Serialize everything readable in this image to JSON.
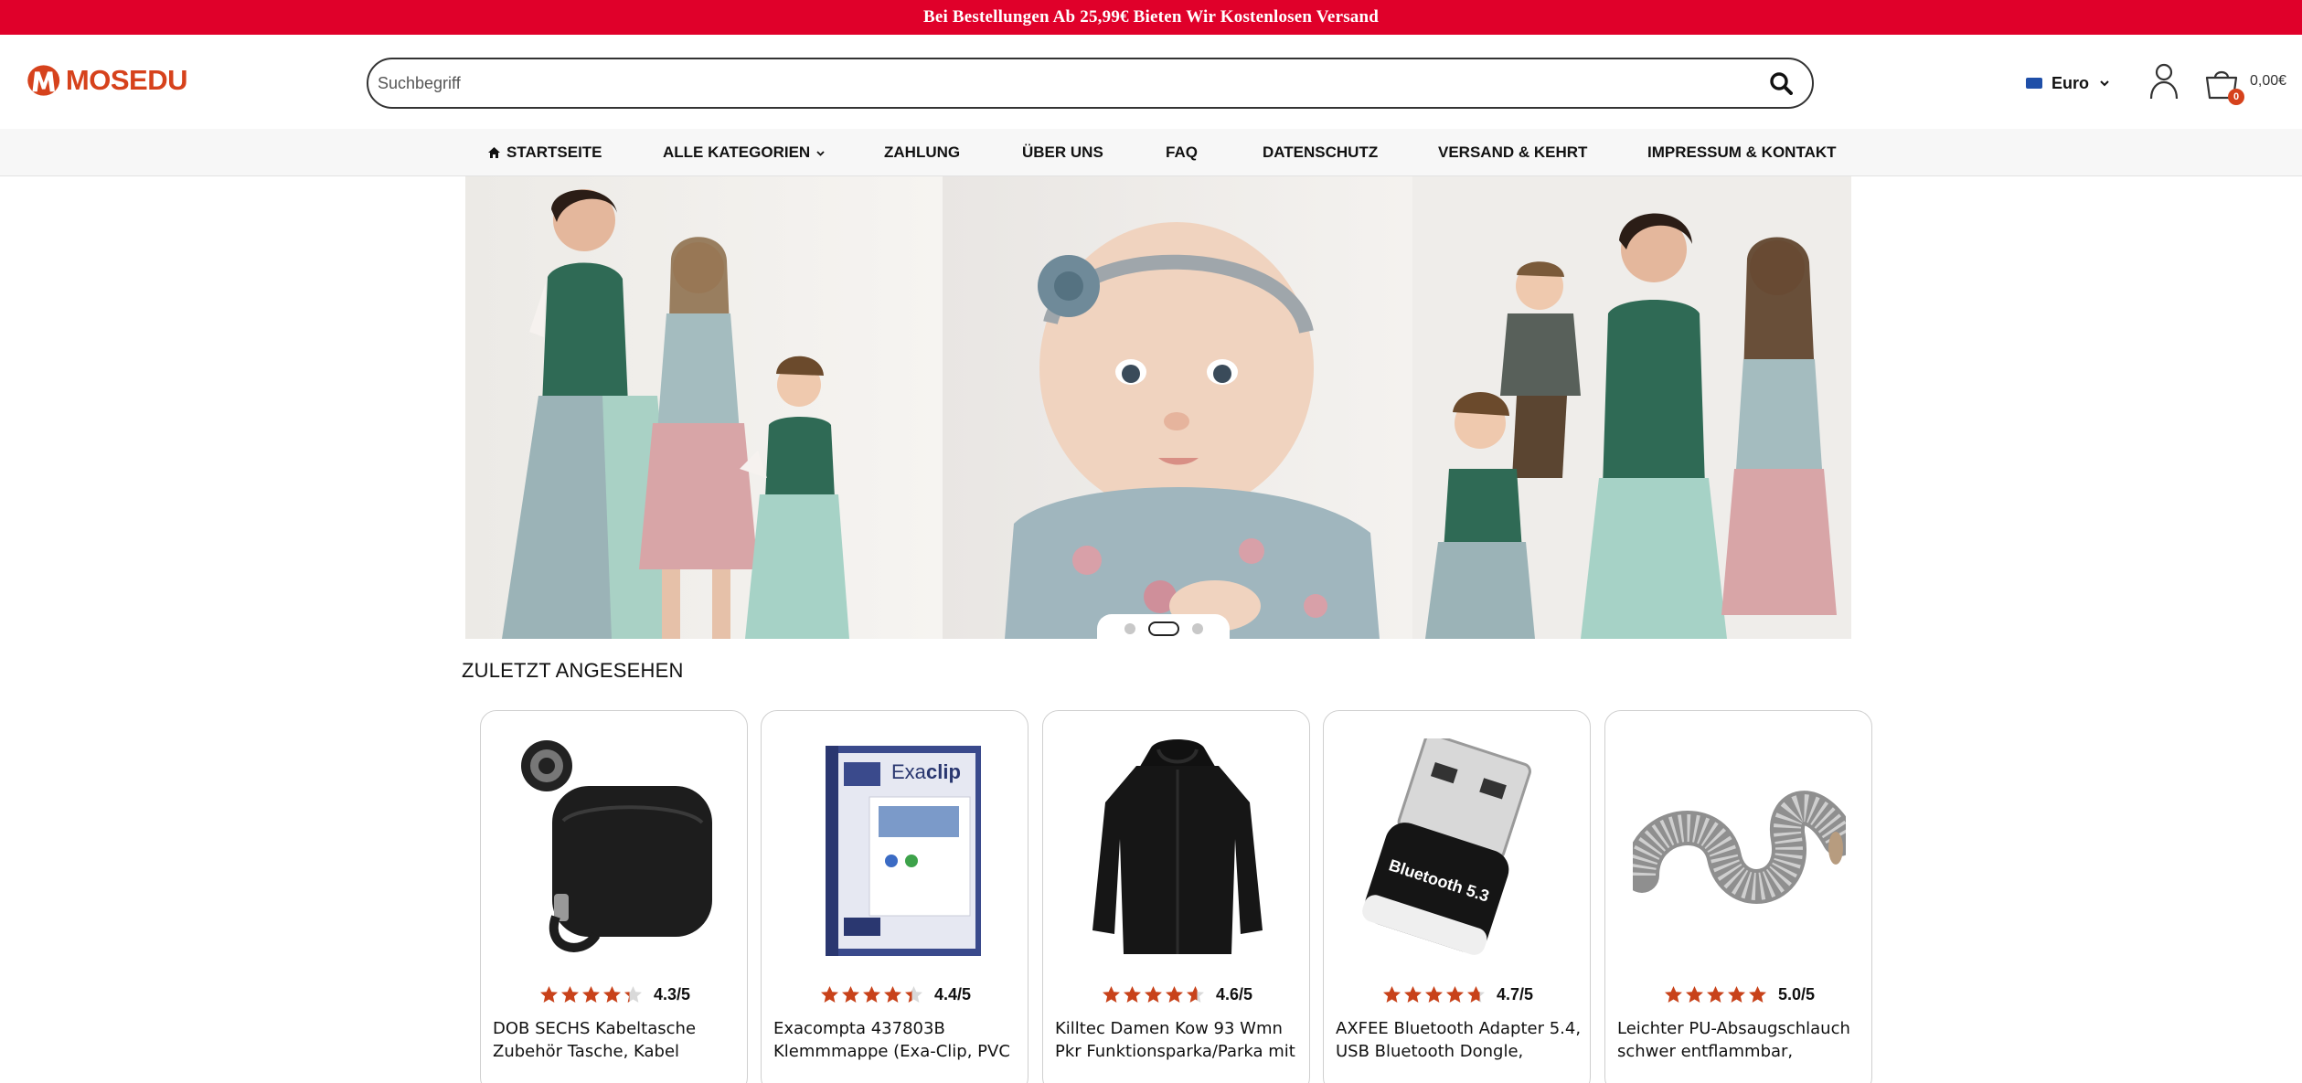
{
  "promo": {
    "text": "Bei Bestellungen Ab 25,99€ Bieten Wir Kostenlosen Versand"
  },
  "header": {
    "logo_text": "MOSEDU",
    "search_placeholder": "Suchbegriff",
    "currency_label": "Euro",
    "cart_count": "0",
    "cart_total": "0,00€"
  },
  "nav": {
    "items": [
      {
        "label": "STARTSEITE",
        "icon": "home-icon"
      },
      {
        "label": "ALLE KATEGORIEN",
        "icon": "chevron-down-icon"
      },
      {
        "label": "ZAHLUNG"
      },
      {
        "label": "ÜBER UNS"
      },
      {
        "label": "FAQ"
      },
      {
        "label": "DATENSCHUTZ"
      },
      {
        "label": "VERSAND & KEHRT"
      },
      {
        "label": "IMPRESSUM & KONTAKT"
      }
    ]
  },
  "slider": {
    "slide_count": 3,
    "active_index": 1
  },
  "recently_viewed": {
    "title": "ZULETZT ANGESEHEN",
    "products": [
      {
        "rating": 4.3,
        "rating_text": "4.3/5",
        "title": "DOB SECHS Kabeltasche Zubehör Tasche, Kabel",
        "image": "black-cable-pouch"
      },
      {
        "rating": 4.4,
        "rating_text": "4.4/5",
        "title": "Exacompta 437803B Klemmmappe (Exa-Clip, PVC",
        "image": "clip-folder"
      },
      {
        "rating": 4.6,
        "rating_text": "4.6/5",
        "title": "Killtec Damen Kow 93 Wmn Pkr Funktionsparka/Parka mit",
        "image": "black-parka"
      },
      {
        "rating": 4.7,
        "rating_text": "4.7/5",
        "title": "AXFEE Bluetooth Adapter 5.4, USB Bluetooth Dongle,",
        "image": "bluetooth-dongle"
      },
      {
        "rating": 5.0,
        "rating_text": "5.0/5",
        "title": "Leichter PU-Absaugschlauch schwer entflammbar,",
        "image": "suction-hose"
      }
    ]
  },
  "colors": {
    "promo_bg": "#e0002a",
    "brand": "#d6421c",
    "star": "#c8421a"
  }
}
